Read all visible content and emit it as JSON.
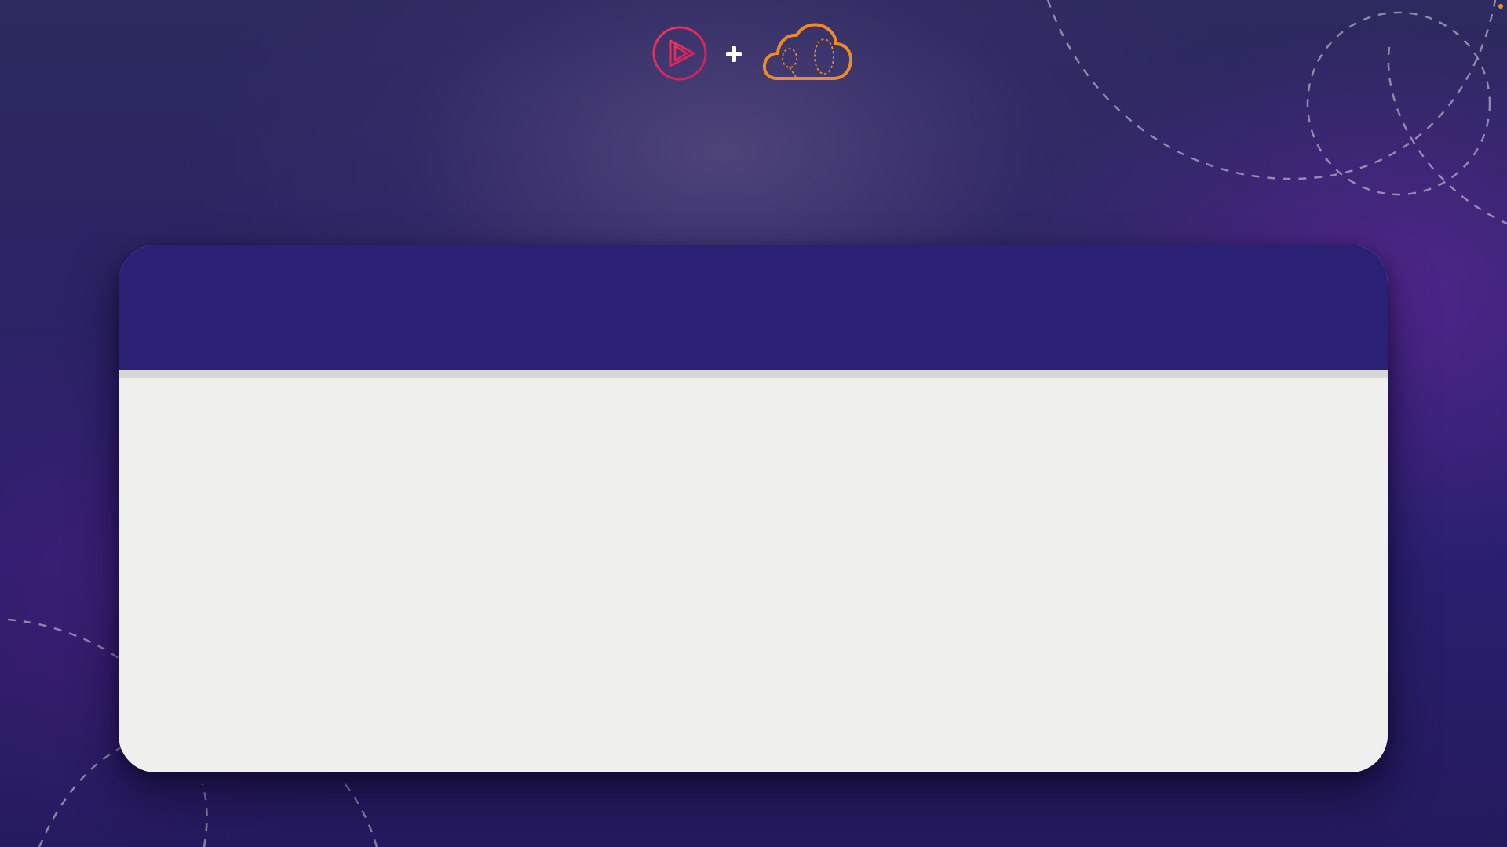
{
  "colors": {
    "background": "#2a2270",
    "card_header": "#2a2076",
    "card_body": "#eff0ee",
    "card_divider": "#d7d8d6",
    "play_logo": "#e0245e",
    "plus": "#ffffff",
    "cloud_logo": "#f08a24"
  },
  "logos": {
    "left_icon": "play-circle-icon",
    "separator_icon": "plus-icon",
    "right_icon": "cloud-icon"
  },
  "card": {
    "header_title": "",
    "body_text": ""
  }
}
